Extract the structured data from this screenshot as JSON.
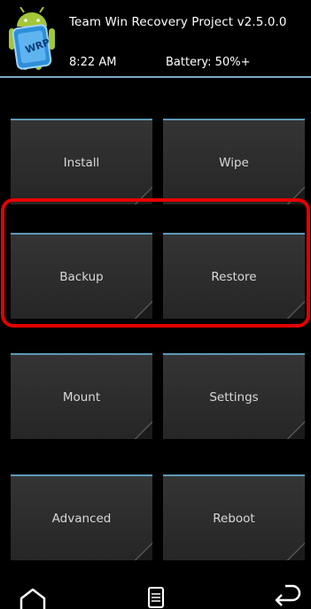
{
  "header": {
    "title": "Team Win Recovery Project  v2.5.0.0",
    "time": "8:22 AM",
    "battery": "Battery: 50%+"
  },
  "menu": [
    {
      "label": "Install"
    },
    {
      "label": "Wipe"
    },
    {
      "label": "Backup"
    },
    {
      "label": "Restore"
    },
    {
      "label": "Mount"
    },
    {
      "label": "Settings"
    },
    {
      "label": "Advanced"
    },
    {
      "label": "Reboot"
    }
  ],
  "highlight": {
    "color": "#e30000",
    "covers": [
      "Backup",
      "Restore"
    ]
  },
  "colors": {
    "accent": "#5f99b8",
    "button_bg": "#2d2d2d",
    "background": "#000000"
  },
  "navbar": {
    "icons": [
      "home-icon",
      "log-console-icon",
      "back-icon"
    ]
  }
}
